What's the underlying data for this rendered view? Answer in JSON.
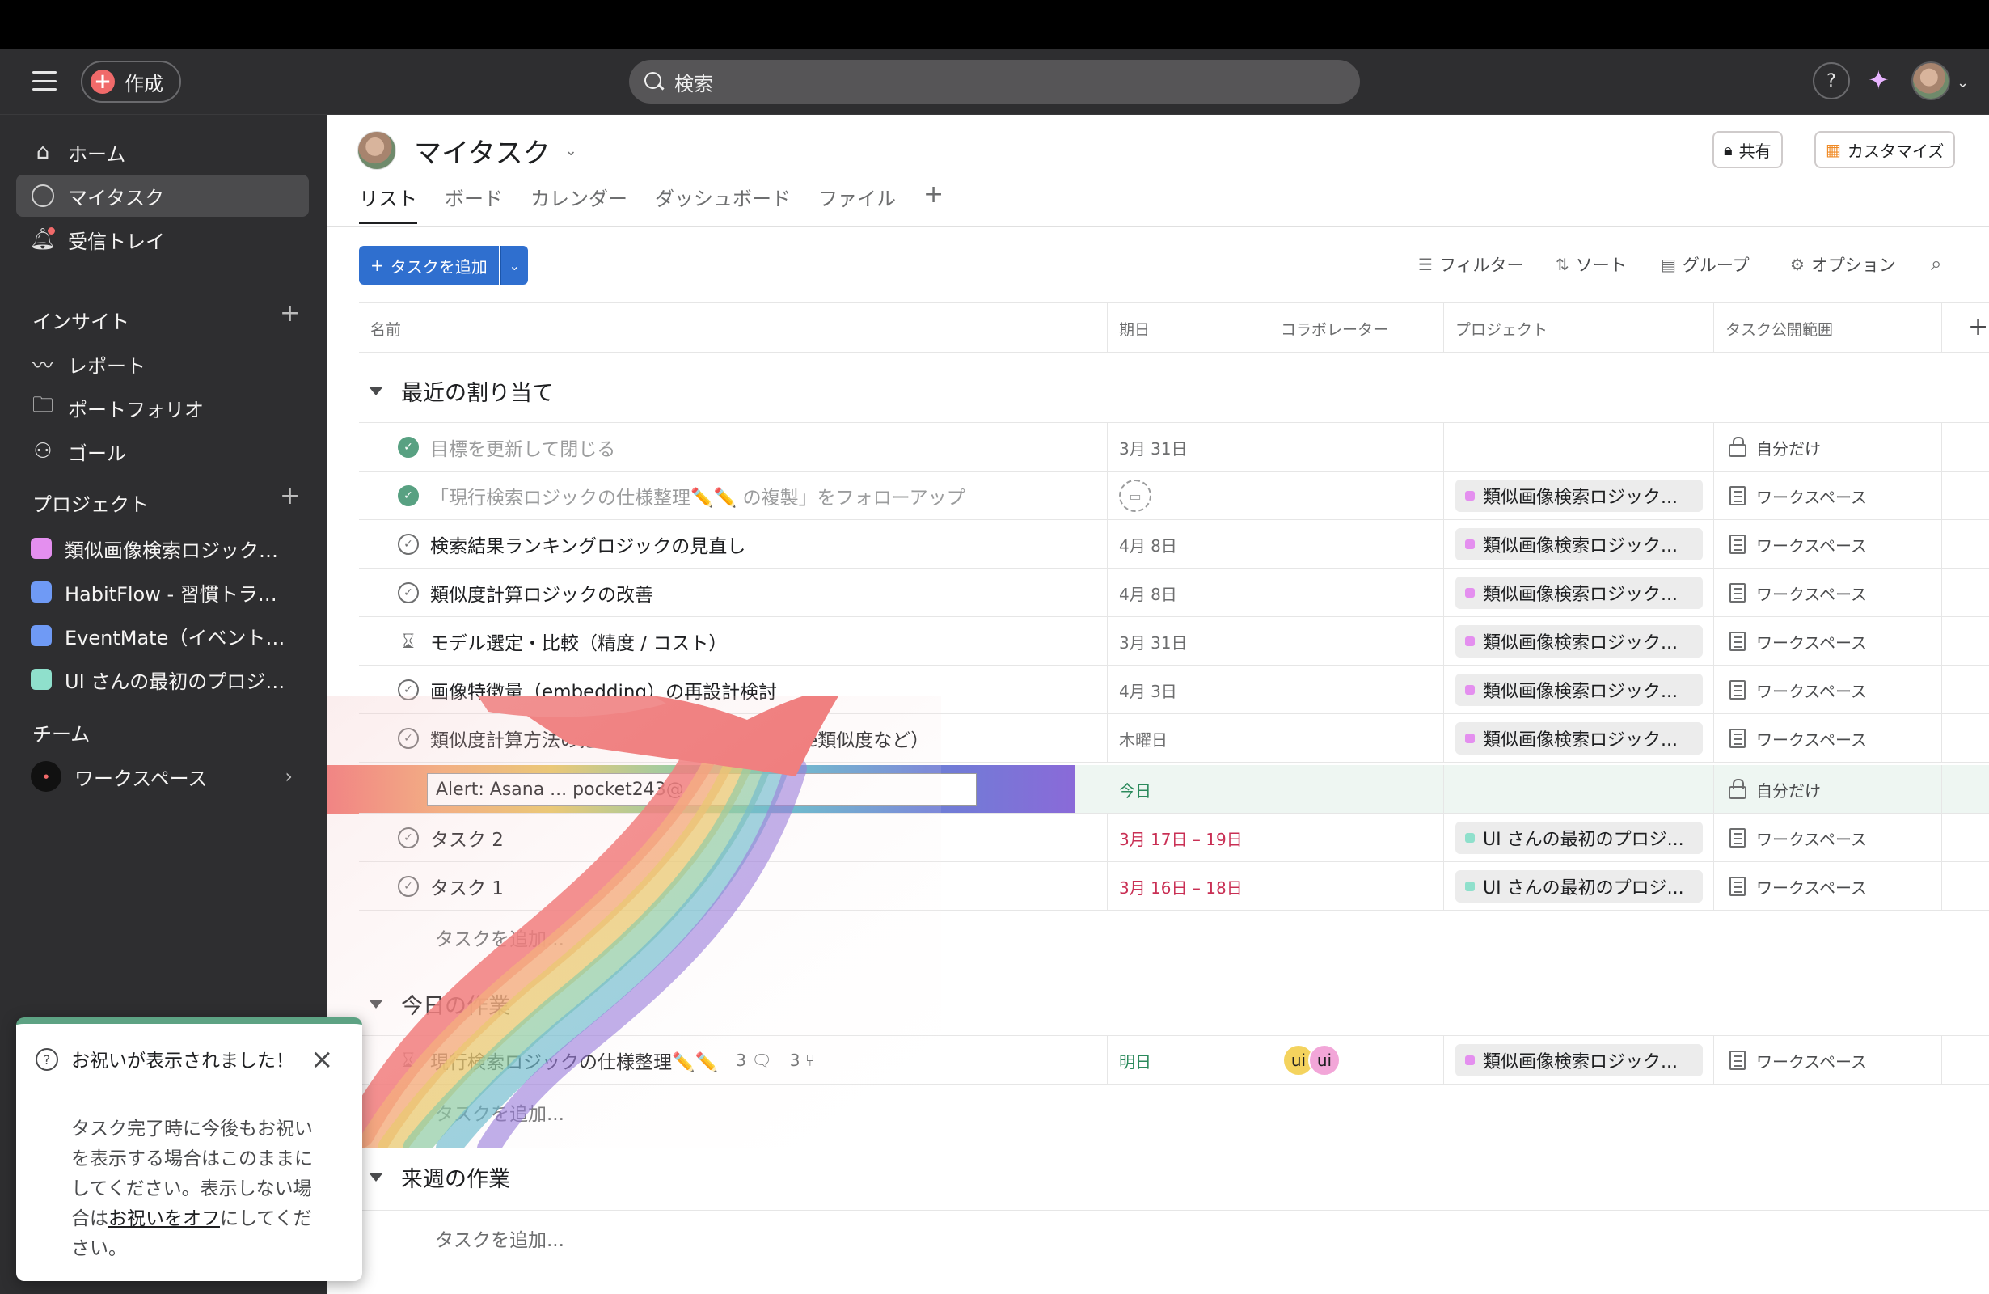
{
  "topbar": {
    "create_label": "作成",
    "search_placeholder": "検索",
    "help_label": "?"
  },
  "sidebar": {
    "nav": [
      {
        "label": "ホーム",
        "icon": "home-icon"
      },
      {
        "label": "マイタスク",
        "icon": "check-circle-icon",
        "active": true
      },
      {
        "label": "受信トレイ",
        "icon": "bell-icon"
      }
    ],
    "insights_heading": "インサイト",
    "insights": [
      {
        "label": "レポート",
        "icon": "chart-line-icon"
      },
      {
        "label": "ポートフォリオ",
        "icon": "folder-icon"
      },
      {
        "label": "ゴール",
        "icon": "person-icon"
      }
    ],
    "projects_heading": "プロジェクト",
    "projects": [
      {
        "label": "類似画像検索ロジック改善",
        "color": "#e48fef"
      },
      {
        "label": "HabitFlow - 習慣トラッ...",
        "color": "#6f9af5"
      },
      {
        "label": "EventMate（イベント管...",
        "color": "#6f9af5"
      },
      {
        "label": "UI さんの最初のプロジェ...",
        "color": "#8fe0cc"
      }
    ],
    "team_heading": "チーム",
    "team_item": "ワークスペース"
  },
  "header": {
    "title": "マイタスク",
    "share_label": "共有",
    "customize_label": "カスタマイズ",
    "tabs": [
      "リスト",
      "ボード",
      "カレンダー",
      "ダッシュボード",
      "ファイル"
    ],
    "tab_add": "+"
  },
  "toolbar": {
    "add_task_label": "タスクを追加",
    "filter": "フィルター",
    "sort": "ソート",
    "group": "グループ",
    "options": "オプション"
  },
  "columns": [
    "名前",
    "期日",
    "コラボレーター",
    "プロジェクト",
    "タスク公開範囲"
  ],
  "sections": [
    {
      "title": "最近の割り当て"
    },
    {
      "title": "今日の作業"
    },
    {
      "title": "来週の作業"
    }
  ],
  "rows": [
    {
      "name": "目標を更新して閉じる",
      "date": "3月 31日",
      "project": "",
      "visibility": "自分だけ"
    },
    {
      "name": "「現行検索ロジックの仕様整理✏️✏️ の複製」をフォローアップ",
      "date": "",
      "project": "類似画像検索ロジック...",
      "visibility": "ワークスペース"
    },
    {
      "name": "検索結果ランキングロジックの見直し",
      "date": "4月 8日",
      "project": "類似画像検索ロジック...",
      "visibility": "ワークスペース"
    },
    {
      "name": "類似度計算ロジックの改善",
      "date": "4月 8日",
      "project": "類似画像検索ロジック...",
      "visibility": "ワークスペース"
    },
    {
      "name": "モデル選定・比較（精度 / コスト）",
      "date": "3月 31日",
      "project": "類似画像検索ロジック...",
      "visibility": "ワークスペース"
    },
    {
      "name": "画像特徴量（embedding）の再設計検討",
      "date": "4月 3日",
      "project": "類似画像検索ロジック...",
      "visibility": "ワークスペース"
    },
    {
      "name": "類似度計算方法の把握（embedding / cosine類似度など）",
      "date": "木曜日",
      "project": "類似画像検索ロジック...",
      "visibility": "ワークスペース"
    },
    {
      "name": "Alert: Asana ... pocket243@",
      "date": "今日",
      "project": "",
      "visibility": "自分だけ"
    },
    {
      "name": "タスク 2",
      "date": "3月 17日 – 19日",
      "project": "UI さんの最初のプロジ...",
      "visibility": "ワークスペース"
    },
    {
      "name": "タスク 1",
      "date": "3月 16日 – 18日",
      "project": "UI さんの最初のプロジ...",
      "visibility": "ワークスペース"
    }
  ],
  "today_row": {
    "name": "現行検索ロジックの仕様整理✏️✏️",
    "comments": "3",
    "subtasks": "3",
    "date": "明日",
    "collaborators": [
      "ui",
      "ui"
    ],
    "project": "類似画像検索ロジック...",
    "visibility": "ワークスペース"
  },
  "add_task_row": "タスクを追加...",
  "toast": {
    "title": "お祝いが表示されました！",
    "body": "タスク完了時に今後もお祝いを表示する場合はこのままにしてください。表示しない場合は",
    "link": "お祝いをオフ",
    "body_end": "にしてください。"
  },
  "colors": {
    "accent": "#2f6fcf",
    "pink_project": "#e48fef",
    "teal_project": "#8fe0cc",
    "done": "#58a182",
    "due_red": "#c92f54",
    "due_green": "#2b8a5c"
  }
}
